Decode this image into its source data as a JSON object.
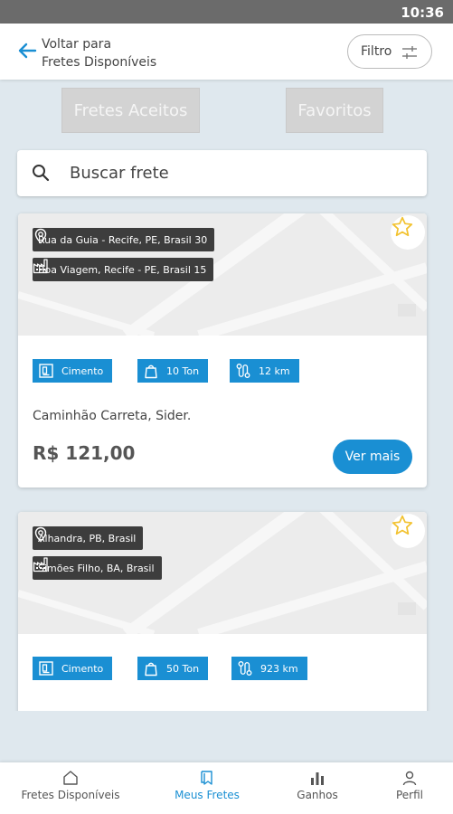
{
  "status_bar": {
    "time": "10:36"
  },
  "header": {
    "back_line1": "Voltar para",
    "back_line2": "Fretes Disponíveis",
    "filter_label": "Filtro"
  },
  "segments": {
    "aceitos": "Fretes Aceitos",
    "favoritos": "Favoritos"
  },
  "search": {
    "placeholder": "Buscar frete"
  },
  "colors": {
    "accent": "#1a8fd3",
    "tag_bg": "#3d3d3d",
    "star": "#f2c230"
  },
  "cards": [
    {
      "origin": "Rua da Guia - Recife, PE, Brasil 30",
      "destination": "Boa Viagem, Recife - PE, Brasil 15",
      "cargo": "Cimento",
      "weight": "10 Ton",
      "distance": "12 km",
      "vehicle": "Caminhão Carreta, Sider.",
      "price": "R$ 121,00",
      "cta": "Ver mais"
    },
    {
      "origin": "Alhandra, PB, Brasil",
      "destination": "Simões Filho, BA, Brasil",
      "cargo": "Cimento",
      "weight": "50 Ton",
      "distance": "923 km"
    }
  ],
  "nav": {
    "items": [
      {
        "label": "Fretes Disponíveis",
        "icon": "home-icon"
      },
      {
        "label": "Meus Fretes",
        "icon": "book-icon",
        "active": true
      },
      {
        "label": "Ganhos",
        "icon": "bar-chart-icon"
      },
      {
        "label": "Perfil",
        "icon": "user-icon"
      }
    ]
  }
}
